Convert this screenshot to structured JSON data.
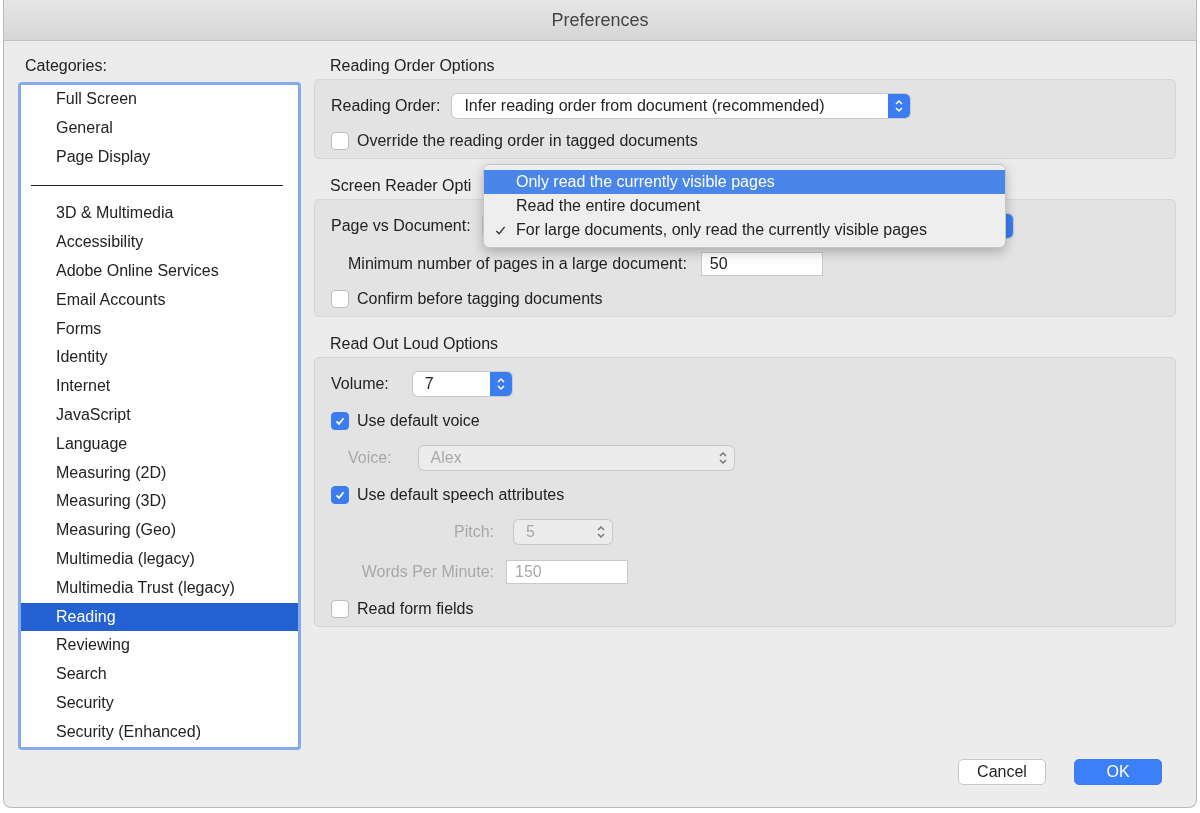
{
  "window": {
    "title": "Preferences"
  },
  "categories": {
    "label": "Categories:",
    "groups": [
      [
        {
          "label": "Full Screen",
          "selected": false
        },
        {
          "label": "General",
          "selected": false
        },
        {
          "label": "Page Display",
          "selected": false
        }
      ],
      [
        {
          "label": "3D & Multimedia",
          "selected": false
        },
        {
          "label": "Accessibility",
          "selected": false
        },
        {
          "label": "Adobe Online Services",
          "selected": false
        },
        {
          "label": "Email Accounts",
          "selected": false
        },
        {
          "label": "Forms",
          "selected": false
        },
        {
          "label": "Identity",
          "selected": false
        },
        {
          "label": "Internet",
          "selected": false
        },
        {
          "label": "JavaScript",
          "selected": false
        },
        {
          "label": "Language",
          "selected": false
        },
        {
          "label": "Measuring (2D)",
          "selected": false
        },
        {
          "label": "Measuring (3D)",
          "selected": false
        },
        {
          "label": "Measuring (Geo)",
          "selected": false
        },
        {
          "label": "Multimedia (legacy)",
          "selected": false
        },
        {
          "label": "Multimedia Trust (legacy)",
          "selected": false
        },
        {
          "label": "Reading",
          "selected": true
        },
        {
          "label": "Reviewing",
          "selected": false
        },
        {
          "label": "Search",
          "selected": false
        },
        {
          "label": "Security",
          "selected": false
        },
        {
          "label": "Security (Enhanced)",
          "selected": false
        }
      ]
    ]
  },
  "reading_order": {
    "heading": "Reading Order Options",
    "order_label": "Reading Order:",
    "order_value": "Infer reading order from document (recommended)",
    "override": {
      "label": "Override the reading order in tagged documents",
      "checked": false
    }
  },
  "screen_reader": {
    "heading": "Screen Reader Opti",
    "page_label": "Page vs Document:",
    "min_label": "Minimum number of pages in a large document:",
    "min_value": "50",
    "confirm": {
      "label": "Confirm before tagging documents",
      "checked": false
    }
  },
  "read_out_loud": {
    "heading": "Read Out Loud Options",
    "volume_label": "Volume:",
    "volume_value": "7",
    "default_voice": {
      "label": "Use default voice",
      "checked": true
    },
    "voice": {
      "label": "Voice:",
      "value": "Alex",
      "disabled": true
    },
    "default_speech": {
      "label": "Use default speech attributes",
      "checked": true
    },
    "pitch": {
      "label": "Pitch:",
      "value": "5",
      "disabled": true
    },
    "wpm": {
      "label": "Words Per Minute:",
      "value": "150",
      "disabled": true
    },
    "form_fields": {
      "label": "Read form fields",
      "checked": false
    }
  },
  "popup_menu": {
    "items": [
      {
        "label": "Only read the currently visible pages",
        "selected": true,
        "checked": false
      },
      {
        "label": "Read the entire document",
        "selected": false,
        "checked": false
      },
      {
        "label": "For large documents, only read the currently visible pages",
        "selected": false,
        "checked": true
      }
    ]
  },
  "buttons": [
    {
      "label": "Cancel",
      "kind": "normal"
    },
    {
      "label": "OK",
      "kind": "default"
    }
  ]
}
